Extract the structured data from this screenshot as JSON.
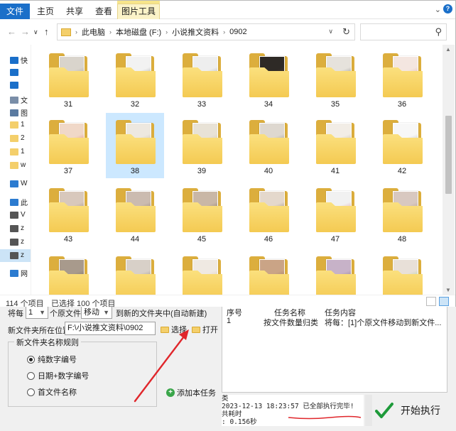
{
  "ribbon": {
    "file_tab": "文件",
    "tabs": [
      "主页",
      "共享",
      "查看"
    ],
    "context_tab": "图片工具"
  },
  "address": {
    "crumbs": [
      "此电脑",
      "本地磁盘 (F:)",
      "小说推文资料",
      "0902"
    ]
  },
  "navpane": {
    "items": [
      {
        "label": "快",
        "icon": "star-icon",
        "color": "#1a6fc9"
      },
      {
        "label": "",
        "icon": "desktop-icon",
        "color": "#1a6fc9"
      },
      {
        "label": "",
        "icon": "download-icon",
        "color": "#1a6fc9"
      },
      {
        "label": "文",
        "icon": "document-icon",
        "color": "#7a8ea8"
      },
      {
        "label": "图",
        "icon": "picture-icon",
        "color": "#5a7aa0"
      },
      {
        "label": "1",
        "icon": "folder-icon",
        "color": "#f4cf6b"
      },
      {
        "label": "2",
        "icon": "folder-icon",
        "color": "#f4cf6b"
      },
      {
        "label": "1",
        "icon": "folder-icon",
        "color": "#f4cf6b"
      },
      {
        "label": "w",
        "icon": "folder-icon",
        "color": "#f4cf6b"
      },
      {
        "label": "W",
        "icon": "cloud-icon",
        "color": "#2b7bd0"
      },
      {
        "label": "此",
        "icon": "computer-icon",
        "color": "#2b7bd0"
      },
      {
        "label": "V",
        "icon": "drive-icon",
        "color": "#555555"
      },
      {
        "label": "z",
        "icon": "drive-icon",
        "color": "#555555"
      },
      {
        "label": "z",
        "icon": "drive-icon",
        "color": "#555555"
      },
      {
        "label": "z",
        "icon": "drive-icon",
        "color": "#555555"
      },
      {
        "label": "网",
        "icon": "network-icon",
        "color": "#2b7bd0"
      }
    ]
  },
  "folders": [
    {
      "name": "31",
      "c1": "#d9d4cc",
      "c2": "#7b6b60"
    },
    {
      "name": "32",
      "c1": "#f2f2f2",
      "c2": "#444444"
    },
    {
      "name": "33",
      "c1": "#eeeeee",
      "c2": "#666666"
    },
    {
      "name": "34",
      "c1": "#2e2a26",
      "c2": "#6a4a3a"
    },
    {
      "name": "35",
      "c1": "#e6e2dc",
      "c2": "#2a2a2a"
    },
    {
      "name": "36",
      "c1": "#f4e6e0",
      "c2": "#d27a74"
    },
    {
      "name": "37",
      "c1": "#f0d8c8",
      "c2": "#d6262b"
    },
    {
      "name": "38",
      "c1": "#ede8e0",
      "c2": "#9a8b74"
    },
    {
      "name": "39",
      "c1": "#e8e2d6",
      "c2": "#b8a88e"
    },
    {
      "name": "40",
      "c1": "#ded8d0",
      "c2": "#4a4a4a"
    },
    {
      "name": "41",
      "c1": "#f2ede6",
      "c2": "#8a7a66"
    },
    {
      "name": "42",
      "c1": "#f7f7f7",
      "c2": "#6d7a8a"
    },
    {
      "name": "43",
      "c1": "#d8c8bc",
      "c2": "#5a4a40"
    },
    {
      "name": "44",
      "c1": "#cbbbb0",
      "c2": "#4e3a33"
    },
    {
      "name": "45",
      "c1": "#c9b7a6",
      "c2": "#3b2c25"
    },
    {
      "name": "46",
      "c1": "#e4d8cc",
      "c2": "#3a2a22"
    },
    {
      "name": "47",
      "c1": "#f1f1f1",
      "c2": "#c8323a"
    },
    {
      "name": "48",
      "c1": "#d8c8c0",
      "c2": "#8a6e62"
    },
    {
      "name": "",
      "c1": "#a89a8c",
      "c2": "#3d3a38"
    },
    {
      "name": "",
      "c1": "#d8d0c8",
      "c2": "#5a4e44"
    },
    {
      "name": "",
      "c1": "#efe9e2",
      "c2": "#cba88c"
    },
    {
      "name": "",
      "c1": "#caa486",
      "c2": "#6a4a38"
    },
    {
      "name": "",
      "c1": "#c7b2c8",
      "c2": "#4a3a4c"
    },
    {
      "name": "",
      "c1": "#e8e0d8",
      "c2": "#6fbf5a"
    }
  ],
  "status": {
    "count": "114 个项目",
    "selected": "已选择 100 个项目"
  },
  "app": {
    "every_label": "将每",
    "every_value": "1",
    "files_label": "个原文件",
    "action_value": "移动",
    "target_label": "到新的文件夹中(自动新建)",
    "location_label": "新文件夹所在位置:",
    "location_value": "F:\\小说推文资料\\0902",
    "choose_label": "选择",
    "open_label": "打开",
    "rule_group": "新文件夹名称规则",
    "rule_options": [
      "纯数字编号",
      "日期+数字编号",
      "首文件名称"
    ],
    "rule_selected": 0,
    "add_task": "添加本任务",
    "table_headers": [
      "序号",
      "任务名称",
      "任务内容"
    ],
    "table_row": [
      "1",
      "按文件数量归类",
      "将每：[1]个原文件移动到新文件..."
    ],
    "log_lines": [
      "类",
      "2023-12-13 18:23:57 已全部执行完毕! 共耗时",
      ": 0.156秒"
    ],
    "start_button": "开始执行"
  }
}
